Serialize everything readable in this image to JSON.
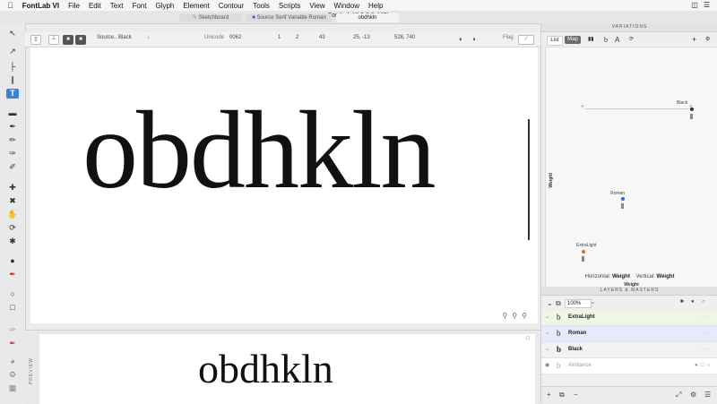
{
  "menubar": {
    "apple_icon": "apple-icon",
    "app": "FontLab VI",
    "items": [
      "File",
      "Edit",
      "Text",
      "Font",
      "Glyph",
      "Element",
      "Contour",
      "Tools",
      "Scripts",
      "View",
      "Window",
      "Help"
    ]
  },
  "window": {
    "title": "FontLab VI 6.0.0.447*",
    "tabs": [
      "Sketchboard",
      "Source Serif Variable Roman",
      "obdhkln"
    ]
  },
  "toolbar": {
    "font_name": "Source.. Black",
    "unicode_label": "Unicode",
    "unicode_value": "0062",
    "stat1": "1",
    "stat2": "2",
    "stat3": "43",
    "coords": "25, -13",
    "size": "528, 740",
    "flag_label": "Flag"
  },
  "canvas": {
    "text": "obdhkln"
  },
  "preview": {
    "label": "PREVIEW",
    "text": "obdhkln"
  },
  "variations": {
    "header": "VARIATIONS",
    "list_label": "List",
    "edit_label": "Map",
    "instances": [
      {
        "name": "ExtraLight",
        "color": "#e06a1a"
      },
      {
        "name": "Roman",
        "color": "#3b5bd9"
      },
      {
        "name": "Black",
        "color": "#333333"
      }
    ],
    "axis_v": "Weight",
    "axis_h": "Weight",
    "horizontal_label": "Horizontal:",
    "horizontal_value": "Weight",
    "vertical_label": "Vertical:",
    "vertical_value": "Weight"
  },
  "layers": {
    "header": "LAYERS & MASTERS",
    "zoom": "100%",
    "rows": [
      {
        "glyph": "b",
        "name": "ExtraLight",
        "bg": "#eef6e4"
      },
      {
        "glyph": "b",
        "name": "Roman",
        "bg": "#e5ebfa"
      },
      {
        "glyph": "b",
        "name": "Black",
        "bg": "#f2f2f2"
      },
      {
        "glyph": "b",
        "name": "#instance",
        "bg": "#ffffff"
      }
    ]
  },
  "colors": {
    "selection": "#3b82d9"
  }
}
